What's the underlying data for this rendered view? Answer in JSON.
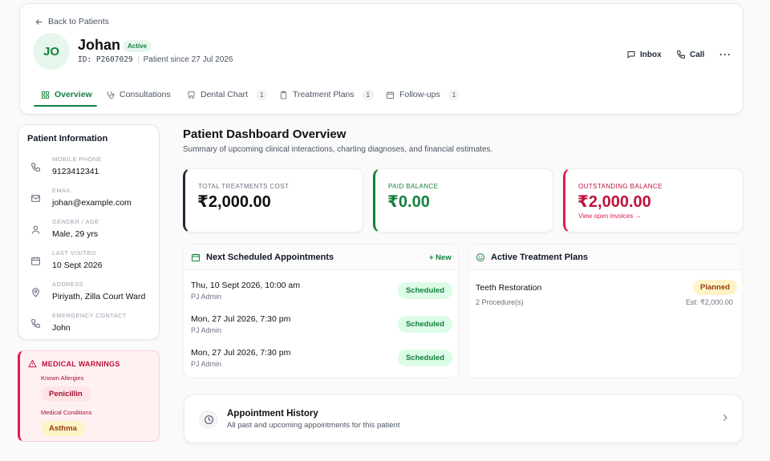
{
  "header": {
    "back_label": "Back to Patients",
    "avatar_initials": "JO",
    "name": "Johan",
    "status": "Active",
    "patient_id": "ID: P2607029",
    "since": "Patient since 27 Jul 2026",
    "actions": {
      "inbox": "Inbox",
      "call": "Call",
      "more": "···"
    },
    "tabs": [
      {
        "label": "Overview",
        "badge": "",
        "icon": "grid-icon",
        "active": true
      },
      {
        "label": "Consultations",
        "badge": "",
        "icon": "stethoscope-icon"
      },
      {
        "label": "Dental Chart",
        "badge": "1",
        "icon": "tooth-icon"
      },
      {
        "label": "Treatment Plans",
        "badge": "1",
        "icon": "clipboard-icon"
      },
      {
        "label": "Follow-ups",
        "badge": "1",
        "icon": "calendar-clock-icon"
      }
    ]
  },
  "patient_info": {
    "title": "Patient Information",
    "rows": [
      {
        "label": "MOBILE PHONE",
        "value": "9123412341",
        "icon": "phone-icon"
      },
      {
        "label": "EMAIL",
        "value": "johan@example.com",
        "icon": "mail-icon"
      },
      {
        "label": "GENDER / AGE",
        "value": "Male, 29 yrs",
        "icon": "user-icon"
      },
      {
        "label": "LAST VISITED",
        "value": "10 Sept 2026",
        "icon": "calendar-icon"
      },
      {
        "label": "ADDRESS",
        "value": "Piriyath, Zilla Court Ward",
        "icon": "map-pin-icon"
      },
      {
        "label": "EMERGENCY CONTACT",
        "value": "John",
        "icon": "phone-icon"
      }
    ]
  },
  "warnings": {
    "title": "MEDICAL WARNINGS",
    "allergies_label": "Known Allergies",
    "allergy": "Penicillin",
    "conditions_label": "Medical Conditions",
    "condition": "Asthma"
  },
  "dashboard": {
    "title": "Patient Dashboard Overview",
    "subtitle": "Summary of upcoming clinical interactions, charting diagnoses, and financial estimates."
  },
  "stats": {
    "total": {
      "label": "TOTAL TREATMENTS COST",
      "value": "₹2,000.00"
    },
    "paid": {
      "label": "PAID BALANCE",
      "value": "₹0.00"
    },
    "outstanding": {
      "label": "OUTSTANDING BALANCE",
      "value": "₹2,000.00",
      "link": "View open invoices →"
    }
  },
  "appointments": {
    "title": "Next Scheduled Appointments",
    "new_label": "+ New",
    "items": [
      {
        "datetime": "Thu, 10 Sept 2026, 10:00 am",
        "doctor": "PJ Admin",
        "status": "Scheduled"
      },
      {
        "datetime": "Mon, 27 Jul 2026, 7:30 pm",
        "doctor": "PJ Admin",
        "status": "Scheduled"
      },
      {
        "datetime": "Mon, 27 Jul 2026, 7:30 pm",
        "doctor": "PJ Admin",
        "status": "Scheduled"
      }
    ]
  },
  "plans": {
    "title": "Active Treatment Plans",
    "items": [
      {
        "name": "Teeth Restoration",
        "procedures": "2 Procedure(s)",
        "status": "Planned",
        "estimate": "Est: ₹2,000.00"
      }
    ]
  },
  "history": {
    "title": "Appointment History",
    "subtitle": "All past and upcoming appointments for this patient"
  },
  "colors": {
    "accent": "#15803d",
    "danger": "#e11d48",
    "warning_bg": "#fef3c7"
  }
}
